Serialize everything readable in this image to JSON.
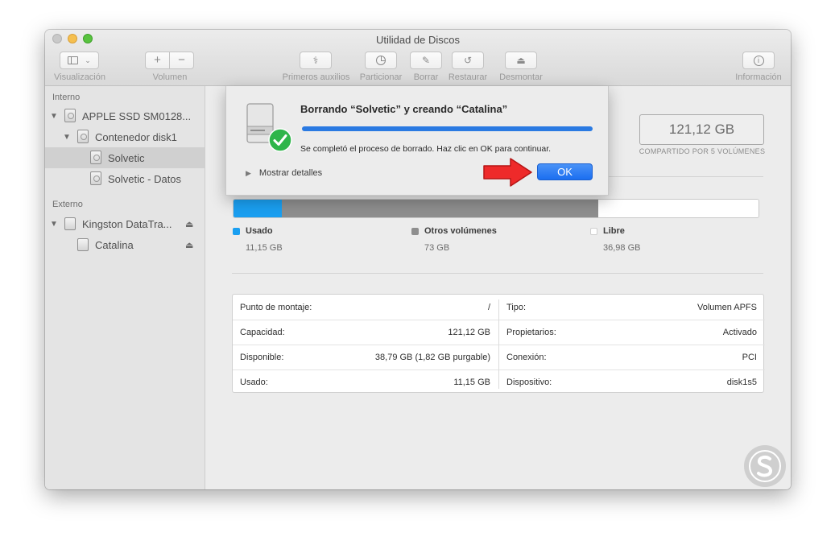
{
  "window": {
    "title": "Utilidad de Discos"
  },
  "toolbar": {
    "view_label": "Visualización",
    "volume_label": "Volumen",
    "add_symbol": "+",
    "remove_symbol": "−",
    "first_aid_label": "Primeros auxilios",
    "partition_label": "Particionar",
    "erase_label": "Borrar",
    "restore_label": "Restaurar",
    "unmount_label": "Desmontar",
    "info_label": "Información"
  },
  "sidebar": {
    "internal_header": "Interno",
    "external_header": "Externo",
    "items": [
      {
        "label": "APPLE SSD SM0128..."
      },
      {
        "label": "Contenedor disk1"
      },
      {
        "label": "Solvetic"
      },
      {
        "label": "Solvetic - Datos"
      },
      {
        "label": "Kingston DataTra..."
      },
      {
        "label": "Catalina"
      }
    ]
  },
  "volume": {
    "capacity": "121,12 GB",
    "shared_caption": "COMPARTIDO POR 5 VOLÚMENES"
  },
  "usage": {
    "colors": {
      "used": "#1a9ff1",
      "other": "#8e8e8e",
      "free": "#ffffff"
    },
    "fractions": {
      "used": 0.092,
      "other": 0.603,
      "free": 0.305
    },
    "legend": [
      {
        "name": "Usado",
        "value": "11,15 GB"
      },
      {
        "name": "Otros volúmenes",
        "value": "73 GB"
      },
      {
        "name": "Libre",
        "value": "36,98 GB"
      }
    ]
  },
  "info": {
    "left": [
      {
        "key": "Punto de montaje:",
        "value": "/"
      },
      {
        "key": "Capacidad:",
        "value": "121,12 GB"
      },
      {
        "key": "Disponible:",
        "value": "38,79 GB (1,82 GB purgable)"
      },
      {
        "key": "Usado:",
        "value": "11,15 GB"
      }
    ],
    "right": [
      {
        "key": "Tipo:",
        "value": "Volumen APFS"
      },
      {
        "key": "Propietarios:",
        "value": "Activado"
      },
      {
        "key": "Conexión:",
        "value": "PCI"
      },
      {
        "key": "Dispositivo:",
        "value": "disk1s5"
      }
    ]
  },
  "dialog": {
    "title": "Borrando “Solvetic” y creando “Catalina”",
    "progress": 1.0,
    "message": "Se completó el proceso de borrado. Haz clic en OK para continuar.",
    "details_label": "Mostrar detalles",
    "ok_label": "OK"
  }
}
